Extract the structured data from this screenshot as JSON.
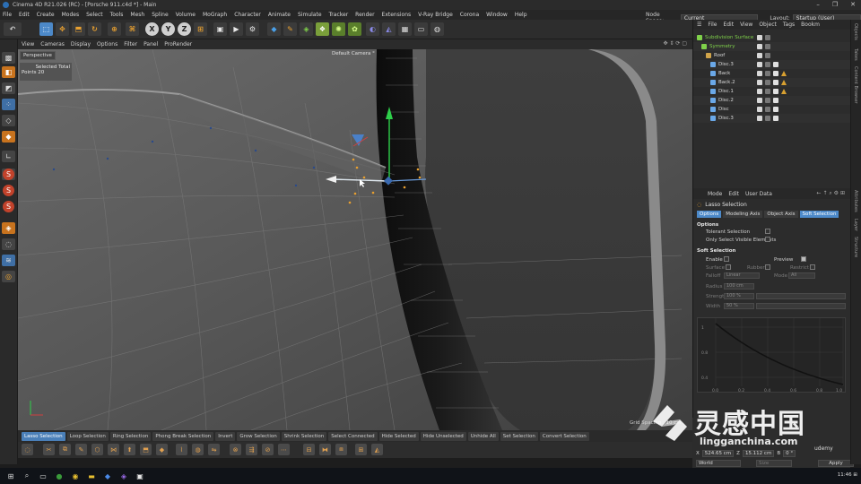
{
  "window": {
    "title": "Cinema 4D R21.026 (RC) - [Porsche 911.c4d *] - Main",
    "controls": [
      "–",
      "❐",
      "✕"
    ]
  },
  "menubar": {
    "items": [
      "File",
      "Edit",
      "Create",
      "Modes",
      "Select",
      "Tools",
      "Mesh",
      "Spline",
      "Volume",
      "MoGraph",
      "Character",
      "Animate",
      "Simulate",
      "Tracker",
      "Render",
      "Extensions",
      "V-Ray Bridge",
      "Corona",
      "Window",
      "Help"
    ],
    "node_space_label": "Node Space:",
    "node_space_value": "Current (Standard/Physical)",
    "layout_label": "Layout:",
    "layout_value": "Startup (User)"
  },
  "toolbar": {
    "axis_x": "X",
    "axis_y": "Y",
    "axis_z": "Z"
  },
  "viewport": {
    "menu": [
      "View",
      "Cameras",
      "Display",
      "Options",
      "Filter",
      "Panel",
      "ProRender"
    ],
    "view_name": "Perspective",
    "camera": "Default Camera °",
    "info_label": "Selected Total",
    "info_points": "Points  20",
    "grid_spacing": "Grid Spacing : 10 cm"
  },
  "selection_bar": [
    "Lasso Selection",
    "Loop Selection",
    "Ring Selection",
    "Phong Break Selection",
    "Invert",
    "Grow Selection",
    "Shrink Selection",
    "Select Connected",
    "Hide Selected",
    "Hide Unselected",
    "Unhide All",
    "Set Selection",
    "Convert Selection"
  ],
  "object_manager": {
    "menu": [
      "File",
      "Edit",
      "View",
      "Object",
      "Tags",
      "Bookm"
    ],
    "objects": [
      {
        "name": "Subdivision Surface",
        "color": "#7fd14a",
        "indent": 0
      },
      {
        "name": "Symmetry",
        "color": "#7fd14a",
        "indent": 1
      },
      {
        "name": "Roof",
        "color": "#d0a44a",
        "indent": 2
      },
      {
        "name": "Disc.3",
        "color": "#6aa8e8",
        "indent": 3
      },
      {
        "name": "Back",
        "color": "#6aa8e8",
        "indent": 3
      },
      {
        "name": "Back.2",
        "color": "#6aa8e8",
        "indent": 3
      },
      {
        "name": "Disc.1",
        "color": "#6aa8e8",
        "indent": 3
      },
      {
        "name": "Disc.2",
        "color": "#6aa8e8",
        "indent": 3
      },
      {
        "name": "Disc",
        "color": "#6aa8e8",
        "indent": 3
      },
      {
        "name": "Disc.3",
        "color": "#6aa8e8",
        "indent": 3
      }
    ]
  },
  "attribute_manager": {
    "menu": [
      "Mode",
      "Edit",
      "User Data"
    ],
    "tool_name": "Lasso Selection",
    "tabs": [
      "Options",
      "Modeling Axis",
      "Object Axis",
      "Soft Selection"
    ],
    "options_title": "Options",
    "tolerant_label": "Tolerant Selection",
    "visible_label": "Only Select Visible Elements",
    "soft_title": "Soft Selection",
    "enable_label": "Enable",
    "preview_label": "Preview",
    "surface_label": "Surface",
    "rubber_label": "Rubber",
    "restrict_label": "Restrict",
    "falloff_label": "Falloff",
    "falloff_value": "Linear",
    "mode_label": "Mode",
    "mode_value": "All",
    "radius_label": "Radius",
    "radius_value": "100 cm",
    "strength_label": "Strength",
    "strength_value": "100 %",
    "width_label": "Width",
    "width_value": "50 %",
    "curve_ticks_y": [
      "1",
      "0.8",
      "0.4"
    ],
    "curve_ticks_x": [
      "0.0",
      "0.2",
      "0.4",
      "0.6",
      "0.8",
      "1.0"
    ]
  },
  "coordinates": {
    "x_value": "524.65 cm",
    "y_value": "15.112 cm",
    "z_value": "0 °",
    "world": "World",
    "size": "Size",
    "apply": "Apply"
  },
  "right_dock": [
    "Objects",
    "Takes",
    "Content Browser",
    "Layers",
    "Attributes",
    "Layer",
    "Structure"
  ],
  "watermark": {
    "cn": "灵感中国",
    "url": "lingganchina.com",
    "udemy": "udemy"
  },
  "taskbar": {
    "time": "11:46 ⊞"
  }
}
